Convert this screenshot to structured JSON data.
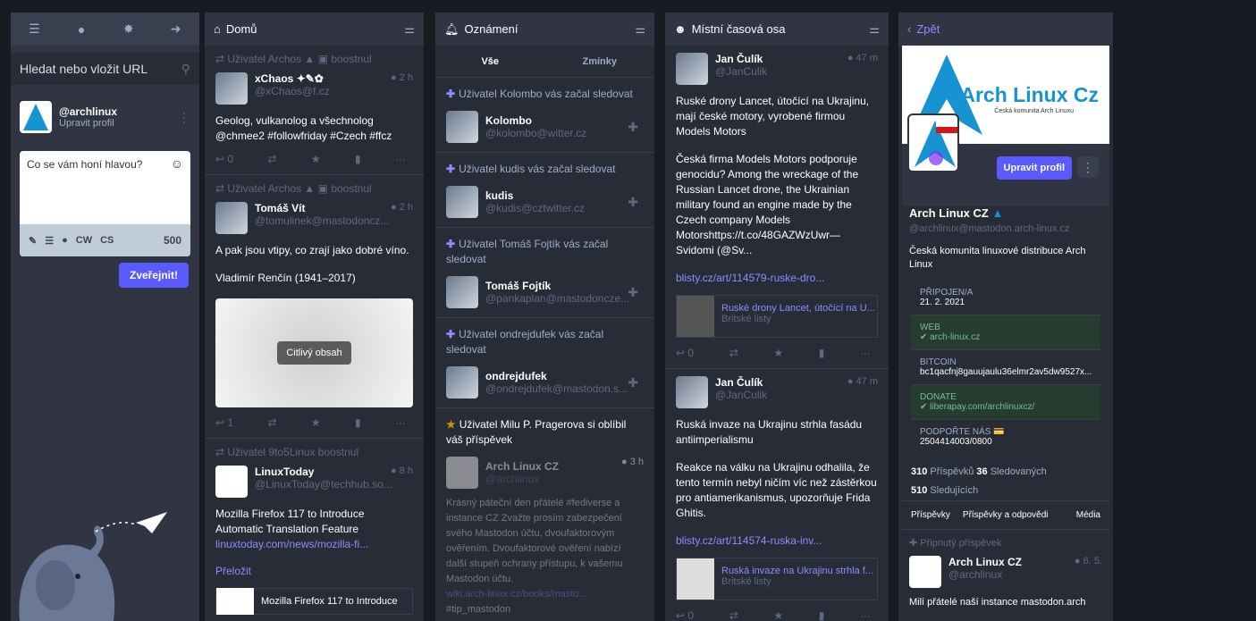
{
  "drawer": {
    "search_placeholder": "Hledat nebo vložit URL",
    "account": "@archlinux",
    "edit_profile": "Upravit profil",
    "compose_placeholder": "Co se vám honí hlavou?",
    "cw": "CW",
    "lang": "CS",
    "count": "500",
    "publish": "Zveřejnit!"
  },
  "home": {
    "title": "Domů",
    "s1": {
      "prepend": "Uživatel Archos",
      "boosted": "boostnul",
      "name": "xChaos",
      "acct": "@xChaos@f.cz",
      "time": "2 h",
      "text": "Geolog, vulkanolog a všechnolog @chmee2 #followfriday #Czech #ffcz",
      "replies": "0"
    },
    "s2": {
      "prepend": "Uživatel Archos",
      "boosted": "boostnul",
      "name": "Tomáš Vít",
      "acct": "@tomulinek@mastodoncz...",
      "time": "2 h",
      "p1": "A pak jsou vtipy, co zrají jako dobré víno.",
      "p2": "Vladimír Renčín (1941–2017)",
      "sensitive": "Citlivý obsah",
      "replies": "1"
    },
    "s3": {
      "prepend": "Uživatel 9to5Linux boostnul",
      "name": "LinuxToday",
      "acct": "@LinuxToday@techhub.so...",
      "time": "8 h",
      "text": "Mozilla Firefox 117 to Introduce Automatic Translation Feature",
      "link": "linuxtoday.com/news/mozilla-fi...",
      "translate": "Přeložit",
      "card": "Mozilla Firefox 117 to Introduce"
    }
  },
  "notif": {
    "title": "Oznámení",
    "tab_all": "Vše",
    "tab_mentions": "Zmínky",
    "n1": {
      "text": "Uživatel Kolombo vás začal sledovat",
      "name": "Kolombo",
      "acct": "@kolombo@witter.cz"
    },
    "n2": {
      "text": "Uživatel kudis vás začal sledovat",
      "name": "kudis",
      "acct": "@kudis@cztwitter.cz"
    },
    "n3": {
      "text": "Uživatel Tomáš Fojtík vás začal sledovat",
      "name": "Tomáš Fojtík",
      "acct": "@pankaplan@mastodoncze..."
    },
    "n4": {
      "text": "Uživatel ondrejdufek vás začal sledovat",
      "name": "ondrejdufek",
      "acct": "@ondrejdufek@mastodon.s..."
    },
    "n5": {
      "text": "Uživatel Milu P. Pragerova si oblíbil váš příspěvek",
      "name": "Arch Linux CZ",
      "acct": "@archlinux",
      "time": "3 h",
      "body": "Krásný páteční den přátelé #fediverse a instance  CZ Zvažte prosím zabezpečení svého Mastodon účtu, dvoufaktorovým ověřením. Dvoufaktorové ověření nabízí další stupeň ochrany přístupu, k vašemu Mastodon účtu.",
      "link": "wiki.arch-linux.cz/books/masto...",
      "tag": "#tip_mastodon"
    }
  },
  "local": {
    "title": "Místní časová osa",
    "s1": {
      "name": "Jan Čulík",
      "acct": "@JanCulik",
      "time": "47 m",
      "p1": "Ruské drony Lancet, útočící na Ukrajinu, mají české motory, vyrobené firmou Models Motors",
      "p2": "Česká firma Models Motors podporuje genocidu? Among the wreckage of the Russian Lancet drone, the Ukrainian military found an engine made by the Czech company Models Motorshttps://t.co/48GAZWzUwr— Svidomi (@Sv...",
      "link": "blisty.cz/art/114579-ruske-dro...",
      "card": "Ruské drony Lancet, útočící na U...",
      "cardsrc": "Britské listy",
      "replies": "0"
    },
    "s2": {
      "name": "Jan Čulík",
      "acct": "@JanCulik",
      "time": "47 m",
      "p1": "Ruská invaze na Ukrajinu strhla fasádu antiimperialismu",
      "p2": "Reakce na válku na Ukrajinu odhalila, že tento termín nebyl ničím víc než zástěrkou pro antiamerikanismus, upozorňuje Frida Ghitis.",
      "link": "blisty.cz/art/114574-ruska-inv...",
      "card": "Ruská invaze na Ukrajinu strhla f...",
      "cardsrc": "Britské listy",
      "replies": "0"
    }
  },
  "profile": {
    "back": "Zpět",
    "banner": "Arch Linux Cz",
    "banner_sub": "Česká komunita Arch Linuxu",
    "edit": "Upravit profil",
    "name": "Arch Linux CZ",
    "acct": "@archlinux@mastodon.arch-linux.cz",
    "bio": "Česká komunita linuxové distribuce Arch Linux",
    "f1k": "PŘIPOJEN/A",
    "f1v": "21. 2. 2021",
    "f2k": "WEB",
    "f2v": "arch-linux.cz",
    "f3k": "BITCOIN",
    "f3v": "bc1qacfnj8gauujaulu36elmr2av5dw9527x...",
    "f4k": "DONATE",
    "f4v": "liberapay.com/archlinuxcz/",
    "f5k": "PODPOŘTE NÁS",
    "f5v": "2504414003/0800",
    "posts": "310",
    "posts_l": "Příspěvků",
    "following": "36",
    "following_l": "Sledovaných",
    "followers": "510",
    "followers_l": "Sledujících",
    "tab1": "Příspěvky",
    "tab2": "Příspěvky a odpovědi",
    "tab3": "Média",
    "pinned": "Připnutý příspěvek",
    "pname": "Arch Linux CZ",
    "pacct": "@archlinux",
    "ptime": "6. 5.",
    "ptext": "Milí přátelé naší instance mastodon.arch"
  },
  "colors": {
    "accent": "#595aff",
    "bg": "#282c37",
    "header": "#313543",
    "verified": "#79bd9a"
  }
}
